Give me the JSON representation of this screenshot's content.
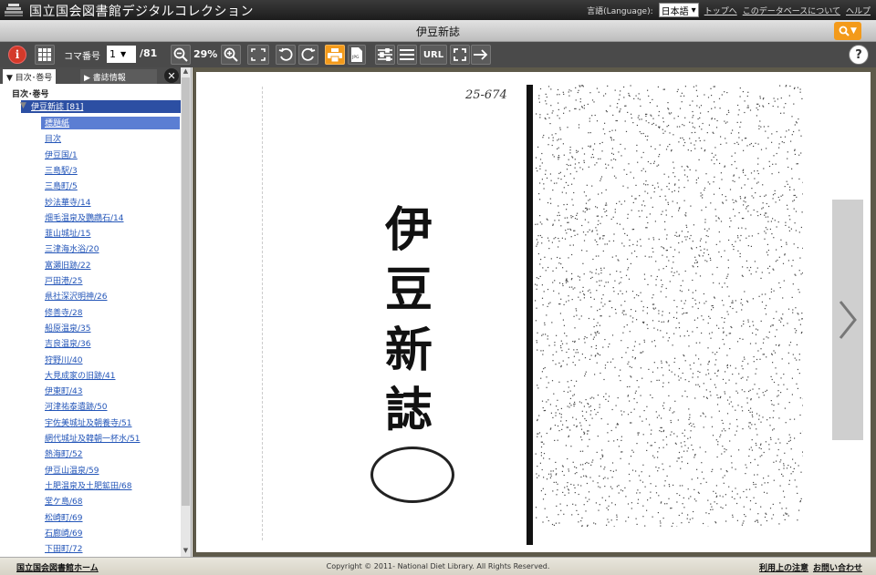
{
  "header": {
    "site_title": "国立国会図書館デジタルコレクション",
    "language_label": "言語(Language):",
    "language_value": "日本語",
    "links": [
      "トップへ",
      "このデータベースについて",
      "ヘルプ"
    ]
  },
  "titlebar": {
    "book_title": "伊豆新誌"
  },
  "toolbar": {
    "page_label": "コマ番号",
    "page_value": "1",
    "page_total": "/81",
    "zoom_value": "29%",
    "url_label": "URL"
  },
  "sidebar": {
    "tab_active": "目次･巻号",
    "tab_other": "書誌情報",
    "heading": "目次･巻号",
    "root_item": "伊豆新誌 [81]",
    "items": [
      "標題紙",
      "目次",
      "伊豆国/1",
      "三島駅/3",
      "三島町/5",
      "妙法華寺/14",
      "畑毛温泉及鸚鵡石/14",
      "韮山城址/15",
      "三津海水浴/20",
      "富瀬旧跡/22",
      "戸田港/25",
      "県社深沢明神/26",
      "修善寺/28",
      "船原温泉/35",
      "吉良温泉/36",
      "狩野川/40",
      "大見成家の旧跡/41",
      "伊東町/43",
      "河津祐泰遺跡/50",
      "宇佐美城址及朝養寺/51",
      "網代城址及韓朝一杯水/51",
      "熱海町/52",
      "伊豆山温泉/59",
      "土肥温泉及土肥鉱田/68",
      "堂ケ島/68",
      "松崎町/69",
      "石廊崎/69",
      "下田町/72"
    ],
    "selected_index": 0
  },
  "viewer": {
    "cover_title": "伊豆新誌",
    "handwritten_number": "25-674"
  },
  "footer": {
    "home_link": "国立国会図書館ホーム",
    "copyright": "Copyright © 2011- National Diet Library. All Rights Reserved.",
    "terms_link": "利用上の注意",
    "contact_link": "お問い合わせ"
  },
  "colors": {
    "accent_orange": "#f39a1a",
    "info_red": "#d43a2a",
    "selection_blue": "#2c4fa3",
    "link_blue": "#2355b8"
  }
}
